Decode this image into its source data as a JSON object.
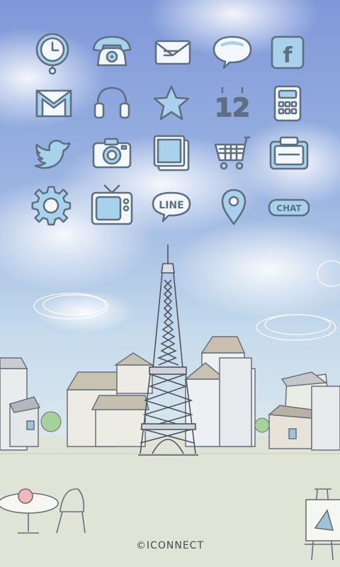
{
  "theme": {
    "sky_top": "#7e97d8",
    "sky_bottom": "#cfe5ef",
    "ground": "#dfe6d7",
    "icon_fill": "#a8d2ec",
    "icon_stroke": "#5f6f82"
  },
  "icons": [
    {
      "name": "clock-icon",
      "row": 0,
      "col": 0
    },
    {
      "name": "phone-icon",
      "row": 0,
      "col": 1
    },
    {
      "name": "message-icon",
      "row": 0,
      "col": 2
    },
    {
      "name": "chat-bubble-icon",
      "row": 0,
      "col": 3
    },
    {
      "name": "facebook-icon",
      "row": 0,
      "col": 4
    },
    {
      "name": "gmail-icon",
      "row": 1,
      "col": 0
    },
    {
      "name": "headphones-icon",
      "row": 1,
      "col": 1
    },
    {
      "name": "star-icon",
      "row": 1,
      "col": 2
    },
    {
      "name": "calendar-icon",
      "row": 1,
      "col": 3
    },
    {
      "name": "calculator-icon",
      "row": 1,
      "col": 4
    },
    {
      "name": "twitter-icon",
      "row": 2,
      "col": 0
    },
    {
      "name": "camera-icon",
      "row": 2,
      "col": 1
    },
    {
      "name": "gallery-icon",
      "row": 2,
      "col": 2
    },
    {
      "name": "shopping-cart-icon",
      "row": 2,
      "col": 3
    },
    {
      "name": "wallet-icon",
      "row": 2,
      "col": 4
    },
    {
      "name": "settings-gear-icon",
      "row": 3,
      "col": 0
    },
    {
      "name": "tv-icon",
      "row": 3,
      "col": 1
    },
    {
      "name": "line-icon",
      "row": 3,
      "col": 2
    },
    {
      "name": "map-pin-icon",
      "row": 3,
      "col": 3
    },
    {
      "name": "chat-app-icon",
      "row": 3,
      "col": 4
    }
  ],
  "labels": {
    "facebook": "f",
    "calendar": "12",
    "line": "LINE",
    "chat": "CHAT",
    "brand": "©ICONNECT"
  }
}
